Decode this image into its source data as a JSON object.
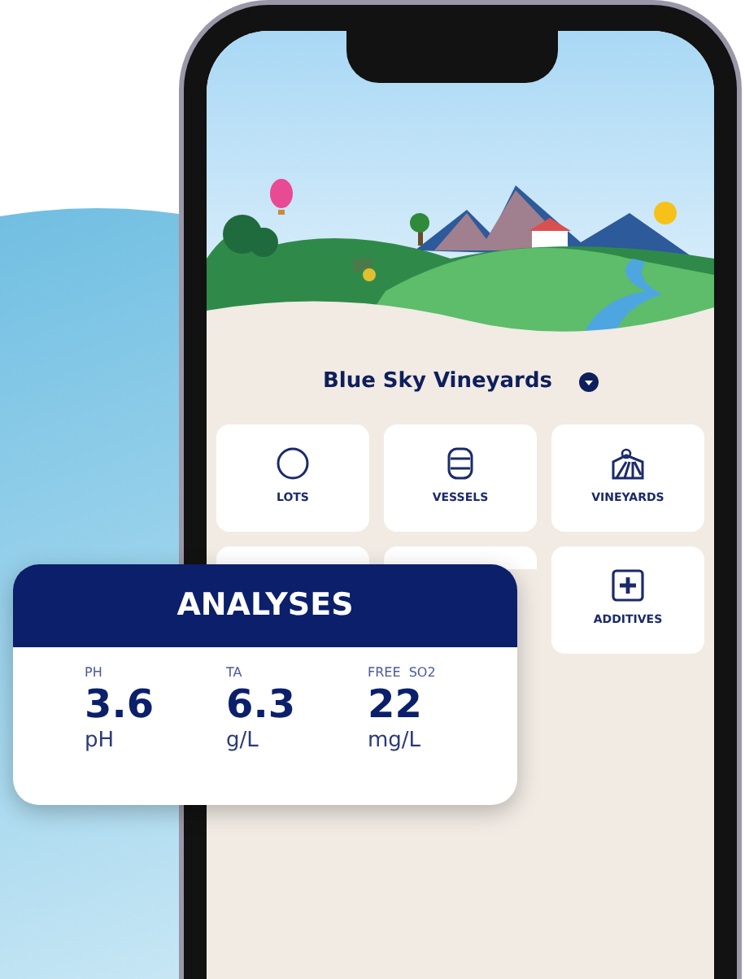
{
  "app": {
    "title": "Blue Sky Vineyards",
    "tiles": [
      {
        "kind": "circle",
        "label": "LOTS"
      },
      {
        "kind": "barrel",
        "label": "VESSELS"
      },
      {
        "kind": "vineyard",
        "label": "VINEYARDS"
      },
      {
        "kind": "blank"
      },
      {
        "kind": "blank"
      },
      {
        "kind": "plus",
        "label": "ADDITIVES"
      }
    ]
  },
  "analyses": {
    "title": "ANALYSES",
    "metrics": [
      {
        "label": "PH",
        "value": "3.6",
        "unit": "pH"
      },
      {
        "label": "TA",
        "value": "6.3",
        "unit": "g/L"
      },
      {
        "label": "FREE  SO2",
        "value": "22",
        "unit": "mg/L"
      }
    ]
  }
}
